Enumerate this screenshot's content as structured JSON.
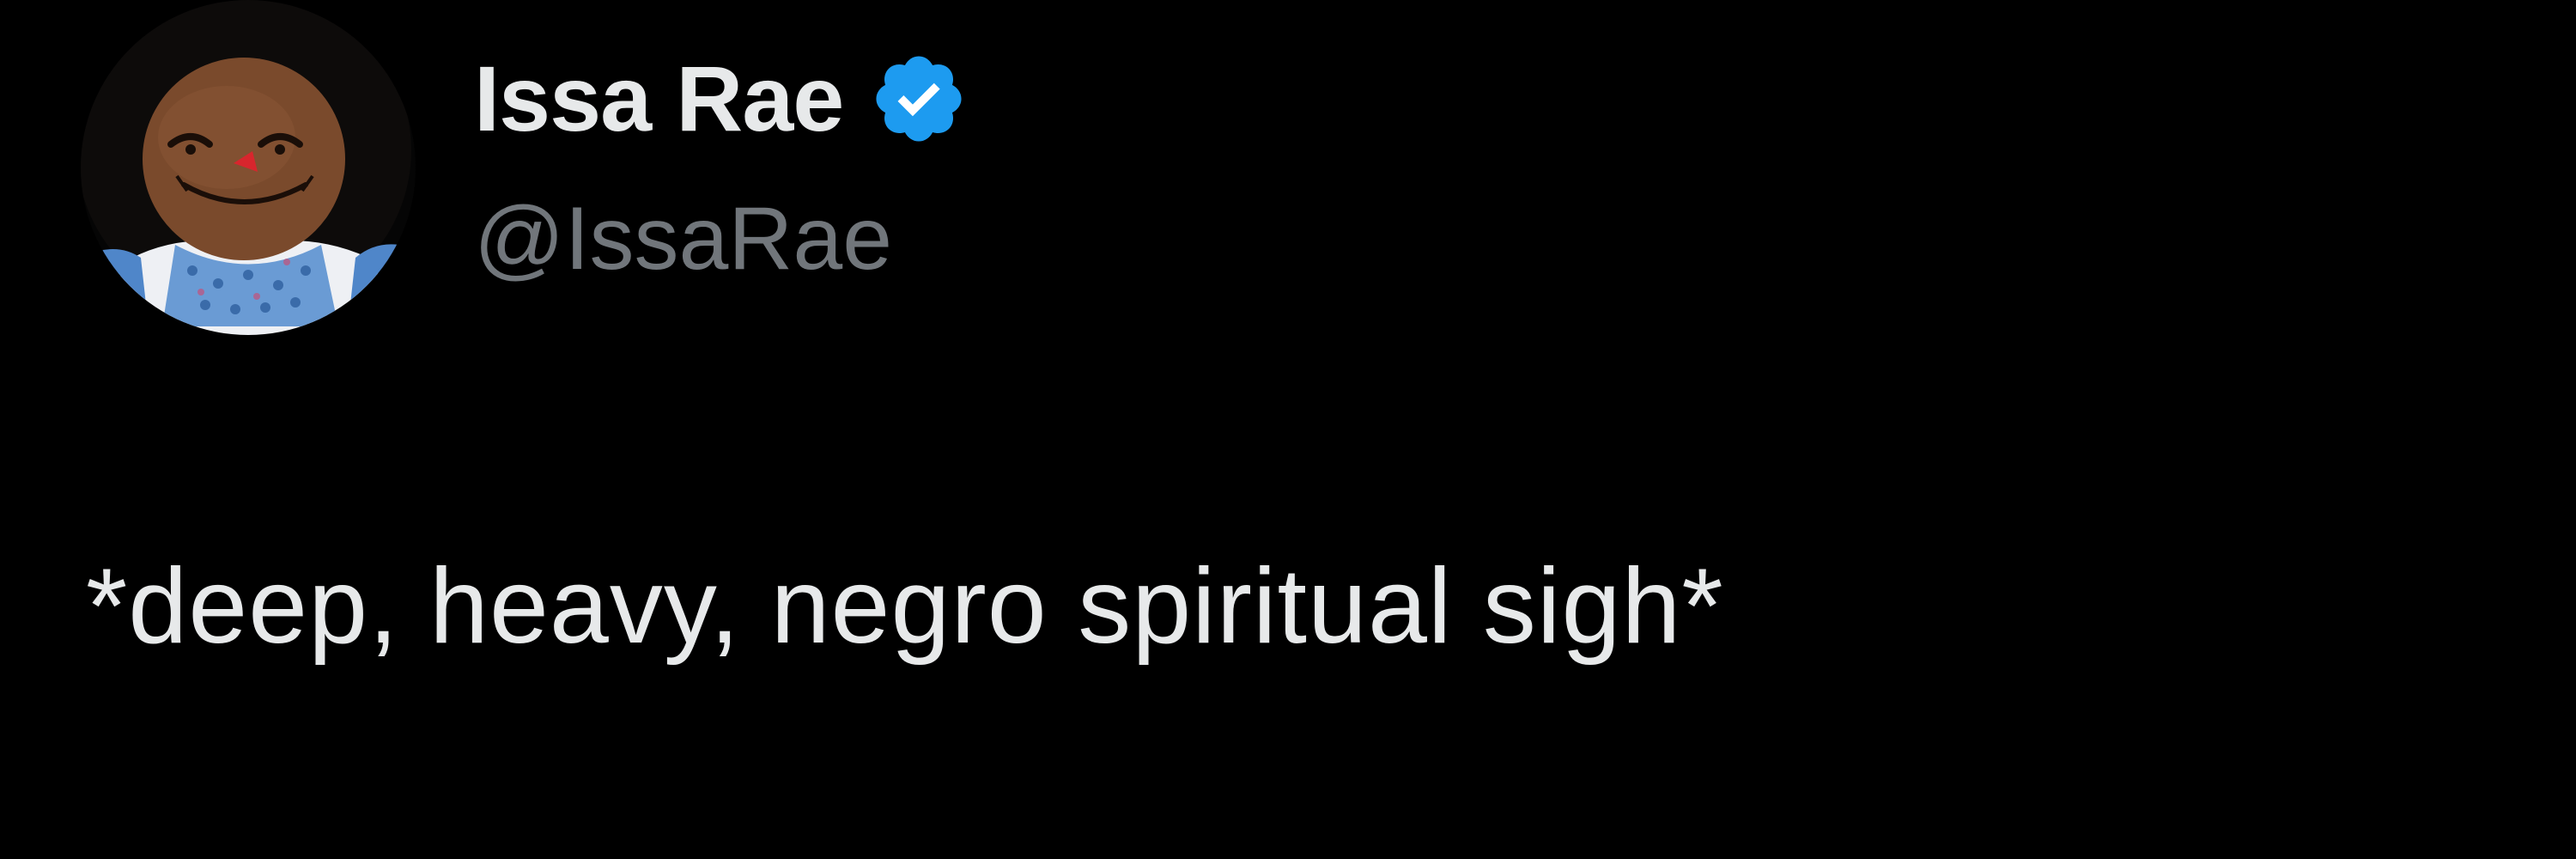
{
  "author": {
    "display_name": "Issa Rae",
    "handle": "@IssaRae",
    "verified": true,
    "avatar_icon": "doll-avatar-icon",
    "verified_icon": "verified-badge-icon"
  },
  "tweet": {
    "text": "*deep, heavy, negro spiritual sigh*"
  },
  "colors": {
    "background": "#000000",
    "primary_text": "#e7e9ea",
    "secondary_text": "#71767b",
    "verified_blue": "#1d9bf0"
  }
}
